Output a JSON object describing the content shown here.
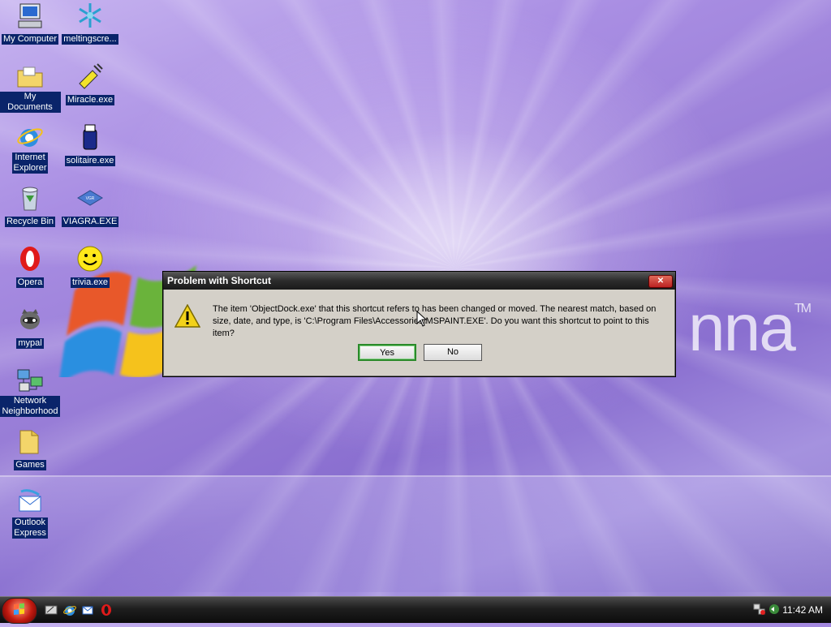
{
  "desktop": {
    "brand_text": "nna",
    "brand_tm": "TM",
    "icons": [
      {
        "label": "My Computer"
      },
      {
        "label": "meltingscre..."
      },
      {
        "label": "My Documents"
      },
      {
        "label": "Miracle.exe"
      },
      {
        "label": "Internet\nExplorer",
        "label_line1": "Internet",
        "label_line2": "Explorer"
      },
      {
        "label": "solitaire.exe"
      },
      {
        "label": "Recycle Bin"
      },
      {
        "label": "VIAGRA.EXE"
      },
      {
        "label": "Opera"
      },
      {
        "label": "trivia.exe"
      },
      {
        "label": "mypal"
      },
      {
        "label": "Network\nNeighborhood",
        "label_line1": "Network",
        "label_line2": "Neighborhood"
      },
      {
        "label": "Games"
      },
      {
        "label": "Outlook\nExpress",
        "label_line1": "Outlook",
        "label_line2": "Express"
      }
    ]
  },
  "dialog": {
    "title": "Problem with Shortcut",
    "message_line1": "The item 'ObjectDock.exe' that this shortcut refers to has been changed or moved. The nearest match, based on",
    "message_line2": "size, date, and type, is 'C:\\Program Files\\Accessories\\MSPAINT.EXE'. Do you want this shortcut to point to this item?",
    "yes_label": "Yes",
    "no_label": "No",
    "close_glyph": "✕"
  },
  "taskbar": {
    "clock": "11:42 AM",
    "quick_launch": [
      "show-desktop-icon",
      "internet-explorer-icon",
      "outlook-icon",
      "opera-icon"
    ]
  },
  "colors": {
    "icon_label_bg": "#0a246a",
    "titlebar": "#2c2c2c",
    "dialog_bg": "#d4d0c8",
    "default_button_border": "#2a8a2a"
  }
}
